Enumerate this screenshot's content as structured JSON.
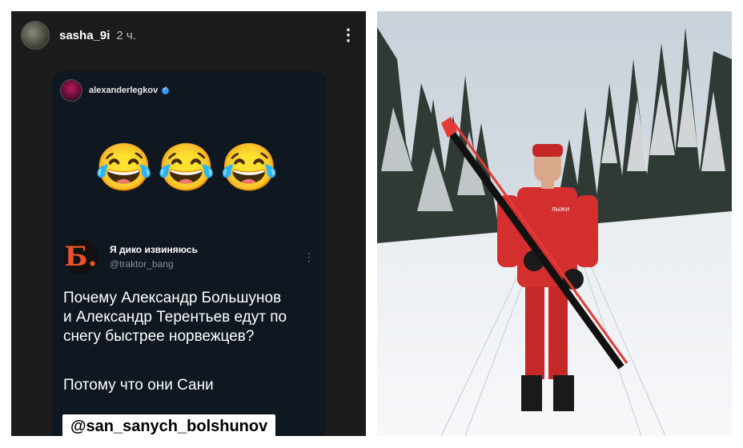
{
  "story": {
    "username": "sasha_9i",
    "time": "2 ч.",
    "post": {
      "author": "alexanderlegkov",
      "emojis": "😂😂😂",
      "tweet": {
        "avatar_letter": "Б.",
        "name": "Я дико извиняюсь",
        "handle": "@traktor_bang",
        "text": "Почему Александр Большунов\nи Александр Терентьев едут по\nснегу быстрее норвежцев?",
        "punchline": "Потому что они Сани"
      },
      "mention_tag": "@san_sanych_bolshunov"
    }
  },
  "photo": {
    "jersey_text": "ЛЫЖИ"
  },
  "colors": {
    "story_bg": "#1c1c1c",
    "post_bg": "#0f1720",
    "verified": "#3897f0",
    "suit_red": "#d32f2f"
  }
}
